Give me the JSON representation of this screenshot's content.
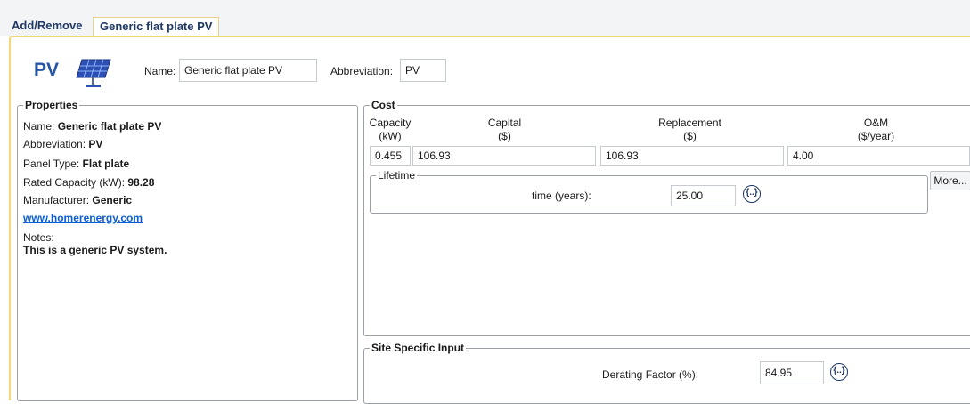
{
  "tabs": {
    "add_remove": "Add/Remove",
    "active": "Generic flat plate PV"
  },
  "header": {
    "component_label": "PV",
    "component_icon": "solar-panel-icon",
    "name_label": "Name:",
    "name_value": "Generic flat plate PV",
    "abbreviation_label": "Abbreviation:",
    "abbreviation_value": "PV"
  },
  "properties": {
    "legend": "Properties",
    "name_label": "Name:",
    "name_value": "Generic flat plate PV",
    "abbreviation_label": "Abbreviation:",
    "abbreviation_value": "PV",
    "panel_type_label": "Panel Type:",
    "panel_type_value": "Flat plate",
    "rated_capacity_label": "Rated Capacity (kW):",
    "rated_capacity_value": "98.28",
    "manufacturer_label": "Manufacturer:",
    "manufacturer_value": "Generic",
    "website": "www.homerenergy.com",
    "notes_label": "Notes:",
    "notes_value": "This is a generic PV system."
  },
  "cost": {
    "legend": "Cost",
    "headers": {
      "capacity": "Capacity",
      "capacity_unit": "(kW)",
      "capital": "Capital",
      "capital_unit": "($)",
      "replacement": "Replacement",
      "replacement_unit": "($)",
      "om": "O&M",
      "om_unit": "($/year)"
    },
    "row": {
      "capacity": "0.455",
      "capital": "106.93",
      "replacement": "106.93",
      "om": "4.00"
    },
    "lifetime_legend": "Lifetime",
    "lifetime_label": "time (years):",
    "lifetime_value": "25.00",
    "sensitivity_glyph": "{..}",
    "more_button": "More..."
  },
  "site": {
    "legend": "Site Specific Input",
    "derating_label": "Derating Factor (%):",
    "derating_value": "84.95",
    "sensitivity_glyph": "{..}"
  },
  "colors": {
    "accent_border": "#f5d67a",
    "title_blue": "#2455a6",
    "tab_text": "#1f3864",
    "link": "#0b5ed7"
  }
}
